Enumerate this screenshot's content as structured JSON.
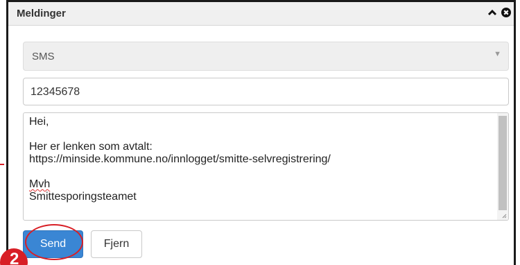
{
  "panel": {
    "title": "Meldinger",
    "collapse_icon": "chevron-up-icon",
    "close_icon": "close-circle-icon"
  },
  "channel_select": {
    "selected": "SMS"
  },
  "phone_input": {
    "value": "12345678"
  },
  "message": {
    "lines": [
      "Hei,",
      "",
      "Her er lenken som avtalt:",
      "https://minside.kommune.no/innlogget/smitte-selvregistrering/",
      "",
      "Mvh",
      "Smittesporingsteamet"
    ]
  },
  "buttons": {
    "send_label": "Send",
    "remove_label": "Fjern"
  },
  "annotation": {
    "step_number": "2",
    "color": "#d81f26"
  },
  "colors": {
    "primary_button": "#3a86d4",
    "header_bg": "#f0f0f0"
  }
}
